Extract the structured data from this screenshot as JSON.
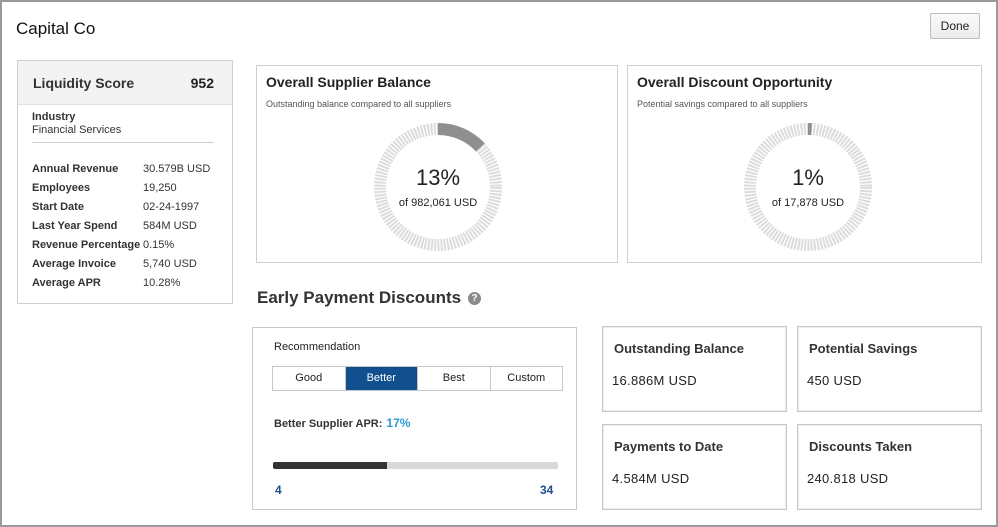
{
  "app": {
    "title": "Capital Co",
    "done_label": "Done"
  },
  "left_panel": {
    "liquidity_label": "Liquidity Score",
    "liquidity_value": "952",
    "industry_label": "Industry",
    "industry_value": "Financial Services",
    "stats": [
      {
        "label": "Annual Revenue",
        "value": "30.579B  USD"
      },
      {
        "label": "Employees",
        "value": "19,250"
      },
      {
        "label": "Start Date",
        "value": "02-24-1997"
      },
      {
        "label": "Last Year Spend",
        "value": "584M  USD"
      },
      {
        "label": "Revenue Percentage",
        "value": "0.15%"
      },
      {
        "label": "Average Invoice",
        "value": "5,740  USD"
      },
      {
        "label": "Average APR",
        "value": "10.28%"
      }
    ]
  },
  "supplier_balance": {
    "title": "Overall Supplier Balance",
    "subtitle": "Outstanding balance compared to all suppliers",
    "percent_label": "13%",
    "percent": 13,
    "of_label": "of 982,061 USD"
  },
  "discount_opportunity": {
    "title": "Overall Discount Opportunity",
    "subtitle": "Potential savings compared to all suppliers",
    "percent_label": "1%",
    "percent": 1,
    "of_label": "of 17,878 USD"
  },
  "early_payment": {
    "heading": "Early Payment Discounts",
    "help_icon": "?",
    "recommendation_label": "Recommendation",
    "options": [
      "Good",
      "Better",
      "Best",
      "Custom"
    ],
    "selected": "Better",
    "apr_label": "Better Supplier APR:",
    "apr_value": "17%",
    "slider_min": "4",
    "slider_max": "34",
    "slider_fraction": 0.4
  },
  "boxes": {
    "outstanding_balance": {
      "title": "Outstanding Balance",
      "value": "16.886M  USD"
    },
    "potential_savings": {
      "title": "Potential Savings",
      "value": "450  USD"
    },
    "payments_to_date": {
      "title": "Payments to Date",
      "value": "4.584M  USD"
    },
    "discounts_taken": {
      "title": "Discounts Taken",
      "value": "240.818  USD"
    }
  },
  "colors": {
    "accent": "#114f8e",
    "apr": "#2a9ad3",
    "donut_track": "#dcdcdc",
    "donut_fill": "#8f8f8f"
  }
}
